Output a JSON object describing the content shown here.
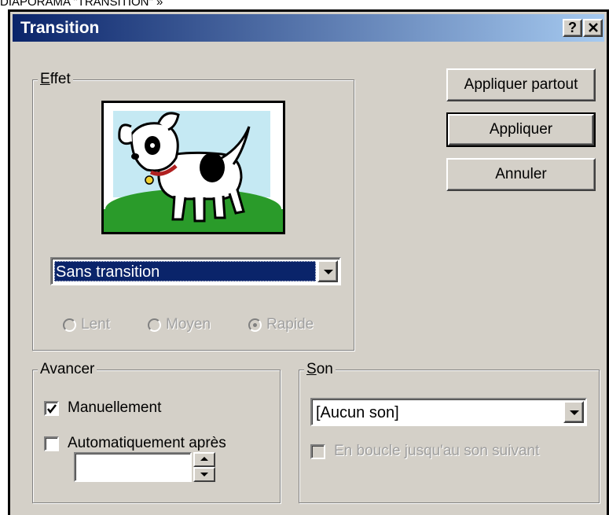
{
  "caption": "DIAPORAMA \"TRANSITION\" »",
  "window": {
    "title": "Transition",
    "help_label": "?"
  },
  "effet": {
    "legend": "Effet",
    "transition_select": "Sans transition",
    "speeds": [
      "Lent",
      "Moyen",
      "Rapide"
    ],
    "selected_speed": "Rapide"
  },
  "buttons": {
    "apply_all": "Appliquer partout",
    "apply": "Appliquer",
    "cancel": "Annuler"
  },
  "avancer": {
    "legend": "Avancer",
    "manual_label": "Manuellement",
    "manual_checked": true,
    "auto_label": "Automatiquement après",
    "auto_checked": false,
    "auto_value": ""
  },
  "son": {
    "legend": "Son",
    "sound_select": "[Aucun son]",
    "loop_label": "En boucle jusqu'au son suivant",
    "loop_checked": false
  },
  "icons": [
    "help-icon",
    "close-icon",
    "dog-preview-image",
    "dropdown-arrow-icon",
    "spin-up-icon",
    "spin-down-icon"
  ]
}
